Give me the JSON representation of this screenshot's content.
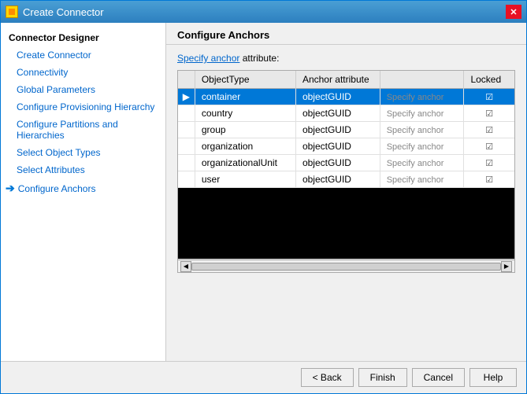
{
  "window": {
    "title": "Create Connector",
    "icon": "gear-icon"
  },
  "sidebar": {
    "header": "Connector Designer",
    "items": [
      {
        "id": "create-connector",
        "label": "Create Connector",
        "indent": 1
      },
      {
        "id": "connectivity",
        "label": "Connectivity",
        "indent": 1
      },
      {
        "id": "global-parameters",
        "label": "Global Parameters",
        "indent": 1
      },
      {
        "id": "configure-provisioning-hierarchy",
        "label": "Configure Provisioning Hierarchy",
        "indent": 1
      },
      {
        "id": "configure-partitions-and-hierarchies",
        "label": "Configure Partitions and Hierarchies",
        "indent": 1
      },
      {
        "id": "select-object-types",
        "label": "Select Object Types",
        "indent": 1
      },
      {
        "id": "select-attributes",
        "label": "Select Attributes",
        "indent": 1
      },
      {
        "id": "configure-anchors",
        "label": "Configure Anchors",
        "indent": 1,
        "arrow": true
      }
    ]
  },
  "panel": {
    "header": "Configure Anchors",
    "specify_anchor_text": "Specify anchor",
    "specify_anchor_rest": " attribute:",
    "table": {
      "columns": [
        {
          "id": "arrow",
          "label": ""
        },
        {
          "id": "objecttype",
          "label": "ObjectType"
        },
        {
          "id": "anchor",
          "label": "Anchor attribute"
        },
        {
          "id": "specify",
          "label": ""
        },
        {
          "id": "locked",
          "label": "Locked"
        }
      ],
      "rows": [
        {
          "arrow": "▶",
          "objectType": "container",
          "anchor": "objectGUID",
          "specify": "Specify anchor",
          "locked": "☑",
          "selected": true
        },
        {
          "arrow": "",
          "objectType": "country",
          "anchor": "objectGUID",
          "specify": "Specify anchor",
          "locked": "☑",
          "selected": false
        },
        {
          "arrow": "",
          "objectType": "group",
          "anchor": "objectGUID",
          "specify": "Specify anchor",
          "locked": "☑",
          "selected": false
        },
        {
          "arrow": "",
          "objectType": "organization",
          "anchor": "objectGUID",
          "specify": "Specify anchor",
          "locked": "☑",
          "selected": false
        },
        {
          "arrow": "",
          "objectType": "organizationalUnit",
          "anchor": "objectGUID",
          "specify": "Specify anchor",
          "locked": "☑",
          "selected": false
        },
        {
          "arrow": "",
          "objectType": "user",
          "anchor": "objectGUID",
          "specify": "Specify anchor",
          "locked": "☑",
          "selected": false
        }
      ]
    }
  },
  "footer": {
    "back_label": "< Back",
    "finish_label": "Finish",
    "cancel_label": "Cancel",
    "help_label": "Help"
  }
}
